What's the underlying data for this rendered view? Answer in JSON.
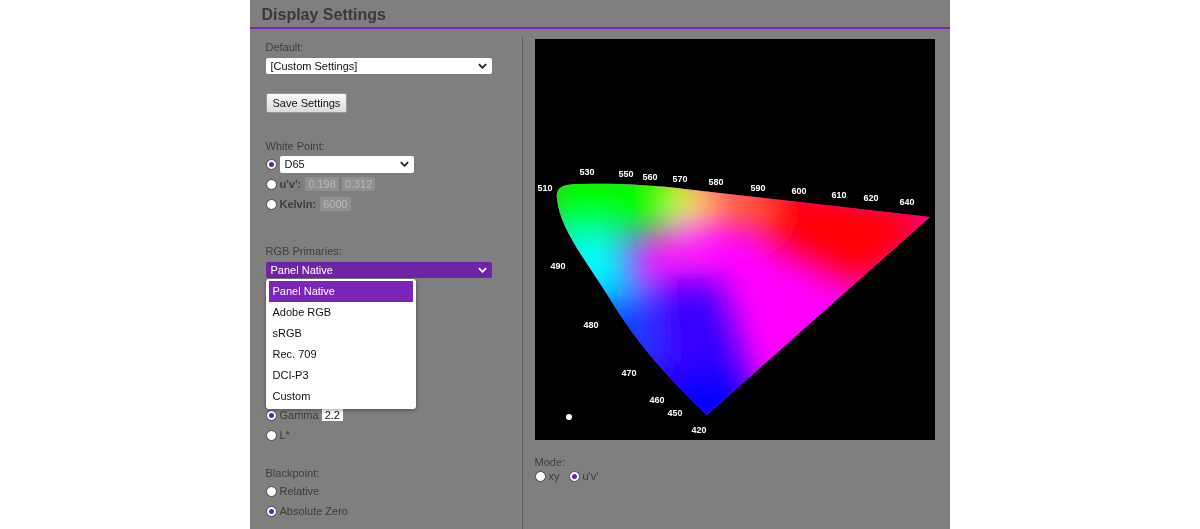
{
  "title": "Display Settings",
  "default": {
    "label": "Default:",
    "value": "[Custom Settings]"
  },
  "save_button": "Save Settings",
  "white_point": {
    "label": "White Point:",
    "options": [
      {
        "kind": "select",
        "selected": true,
        "value": "D65"
      },
      {
        "kind": "fields",
        "selected": false,
        "label": "u'v':",
        "values": [
          "0.198",
          "0.312"
        ]
      },
      {
        "kind": "fields",
        "selected": false,
        "label": "Kelvin:",
        "values": [
          "6000"
        ]
      }
    ]
  },
  "rgb_primaries": {
    "label": "RGB Primaries:",
    "value": "Panel Native",
    "expanded": true,
    "options": [
      {
        "label": "Panel Native",
        "selected": true
      },
      {
        "label": "Adobe RGB",
        "selected": false
      },
      {
        "label": "sRGB",
        "selected": false
      },
      {
        "label": "Rec. 709",
        "selected": false
      },
      {
        "label": "DCI-P3",
        "selected": false
      },
      {
        "label": "Custom",
        "selected": false
      }
    ]
  },
  "tone": {
    "options": [
      {
        "label": "Gamma",
        "selected": true,
        "value": "2.2"
      },
      {
        "label": "L*",
        "selected": false
      }
    ]
  },
  "blackpoint": {
    "label": "Blackpoint:",
    "options": [
      {
        "label": "Relative",
        "selected": false
      },
      {
        "label": "Absolute Zero",
        "selected": true
      }
    ]
  },
  "diagram": {
    "wavelength_labels": [
      "510",
      "530",
      "550",
      "560",
      "570",
      "580",
      "590",
      "600",
      "610",
      "620",
      "640",
      "490",
      "480",
      "470",
      "460",
      "450",
      "420"
    ]
  },
  "mode": {
    "label": "Mode:",
    "options": [
      {
        "label": "xy",
        "selected": false
      },
      {
        "label": "u'v'",
        "selected": true
      }
    ]
  }
}
